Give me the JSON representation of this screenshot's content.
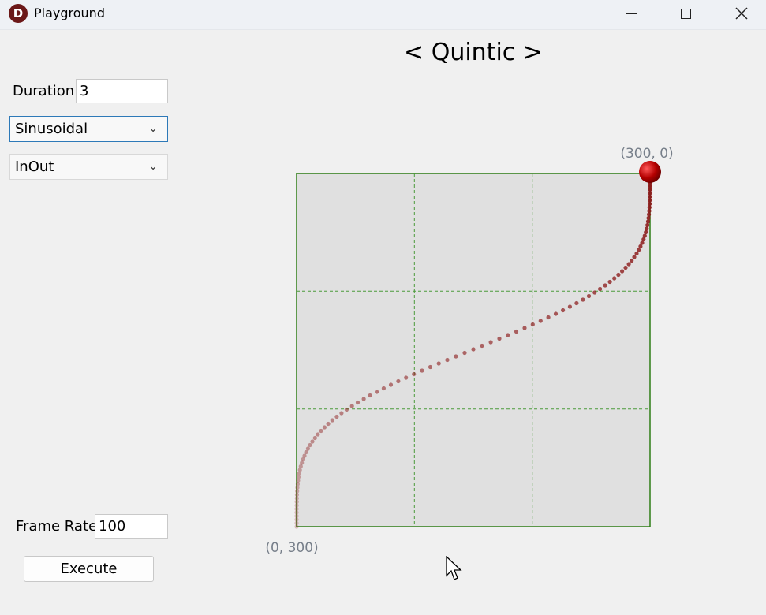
{
  "window": {
    "title": "Playground",
    "icon": "D"
  },
  "chart_title": "< Quintic >",
  "controls": {
    "duration_label": "Duration",
    "duration_value": "3",
    "easing_type": "Sinusoidal",
    "easing_mode": "InOut",
    "frame_rate_label": "Frame Rate",
    "frame_rate_value": "100",
    "execute_label": "Execute"
  },
  "colors": {
    "grid_fill": "#e0e0e0",
    "grid_border": "#2e7d16",
    "trail": "#8b1a1a",
    "ball": "#b40000"
  },
  "chart_data": {
    "type": "scatter",
    "xlim": [
      0,
      300
    ],
    "ylim": [
      0,
      300
    ],
    "grid": true,
    "origin_label": "(0, 300)",
    "end_label": "(300, 0)",
    "curve": "sinusoidal in-out",
    "points": 101
  }
}
